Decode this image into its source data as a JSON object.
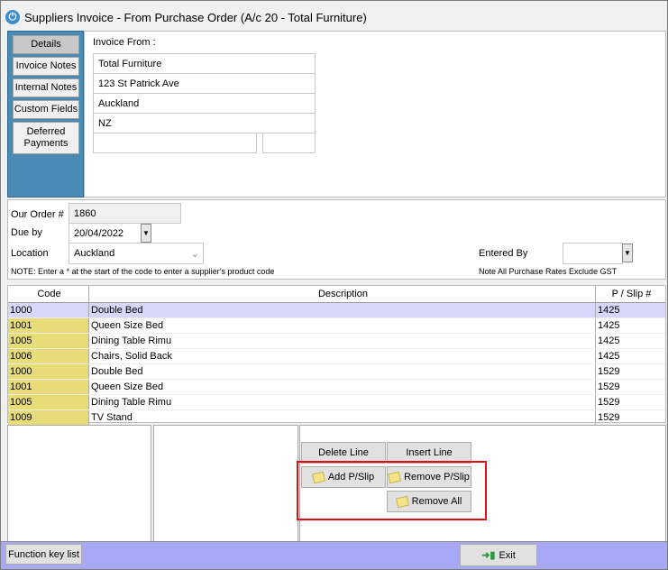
{
  "window": {
    "title": "Suppliers Invoice - From Purchase Order (A/c 20 - Total Furniture)"
  },
  "nav": [
    {
      "label": "Details",
      "active": true
    },
    {
      "label": "Invoice Notes"
    },
    {
      "label": "Internal Notes"
    },
    {
      "label": "Custom Fields"
    },
    {
      "label": "Deferred Payments"
    }
  ],
  "invoice_from": {
    "label": "Invoice From  :",
    "lines": [
      "Total Furniture",
      "123 St Patrick Ave",
      "Auckland",
      "NZ"
    ],
    "extra1": "",
    "extra2": ""
  },
  "order": {
    "our_order_label": "Our Order #",
    "our_order": "1860",
    "due_label": "Due by",
    "due": "20/04/2022",
    "location_label": "Location",
    "location": "Auckland",
    "entered_by_label": "Entered By",
    "entered_by": "",
    "note": "NOTE: Enter a * at the start of the code to enter a supplier's product code",
    "gst_note": "Note All Purchase Rates Exclude GST"
  },
  "grid": {
    "headers": [
      "Code",
      "Description",
      "P / Slip #"
    ],
    "rows": [
      {
        "code": "1000",
        "desc": "Double Bed",
        "slip": "1425"
      },
      {
        "code": "1001",
        "desc": "Queen Size Bed",
        "slip": "1425"
      },
      {
        "code": "1005",
        "desc": "Dining Table Rimu",
        "slip": "1425"
      },
      {
        "code": "1006",
        "desc": "Chairs, Solid Back",
        "slip": "1425"
      },
      {
        "code": "1000",
        "desc": "Double Bed",
        "slip": "1529"
      },
      {
        "code": "1001",
        "desc": "Queen Size Bed",
        "slip": "1529"
      },
      {
        "code": "1005",
        "desc": "Dining Table Rimu",
        "slip": "1529"
      },
      {
        "code": "1009",
        "desc": "TV Stand",
        "slip": "1529"
      }
    ]
  },
  "buttons": {
    "delete_line": "Delete Line",
    "insert_line": "Insert Line",
    "add_pslip": "Add P/Slip",
    "remove_pslip": "Remove P/Slip",
    "remove_all": "Remove All",
    "function_keys": "Function key list",
    "exit": "Exit"
  },
  "colors": {
    "highlight": "#e01010",
    "footer": "#a8a8f8",
    "nav": "#4a8ab5"
  }
}
